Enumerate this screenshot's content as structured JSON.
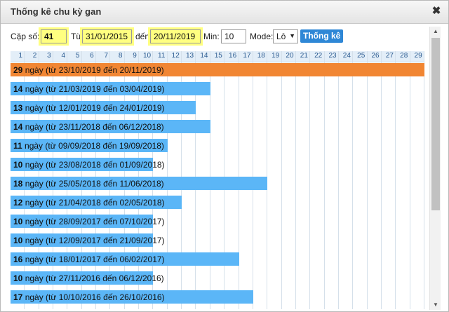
{
  "dialog": {
    "title": "Thống kê chu kỳ gan",
    "close_glyph": "✖"
  },
  "toolbar": {
    "pair_label": "Cặp số:",
    "pair_value": "41",
    "from_label": "Từ",
    "from_value": "31/01/2015",
    "to_label": "đến",
    "to_value": "20/11/2019",
    "min_label": "Min:",
    "min_value": "10",
    "mode_label": "Mode:",
    "mode_value": "Lô",
    "submit_label": "Thống kê"
  },
  "chart_data": {
    "type": "bar",
    "columns": [
      "1",
      "2",
      "3",
      "4",
      "5",
      "6",
      "7",
      "8",
      "9",
      "10",
      "11",
      "12",
      "13",
      "14",
      "15",
      "16",
      "17",
      "18",
      "19",
      "20",
      "21",
      "22",
      "23",
      "24",
      "25",
      "26",
      "27",
      "28",
      "29"
    ],
    "rows": [
      {
        "days": 29,
        "text": " ngày (từ 23/10/2019 đến 20/11/2019)",
        "color": "orange"
      },
      {
        "days": 14,
        "text": " ngày (từ 21/03/2019 đến 03/04/2019)",
        "color": "blue"
      },
      {
        "days": 13,
        "text": " ngày (từ 12/01/2019 đến 24/01/2019)",
        "color": "blue"
      },
      {
        "days": 14,
        "text": " ngày (từ 23/11/2018 đến 06/12/2018)",
        "color": "blue"
      },
      {
        "days": 11,
        "text": " ngày (từ 09/09/2018 đến 19/09/2018)",
        "color": "blue"
      },
      {
        "days": 10,
        "text": " ngày (từ 23/08/2018 đến 01/09/2018)",
        "color": "blue"
      },
      {
        "days": 18,
        "text": " ngày (từ 25/05/2018 đến 11/06/2018)",
        "color": "blue"
      },
      {
        "days": 12,
        "text": " ngày (từ 21/04/2018 đến 02/05/2018)",
        "color": "blue"
      },
      {
        "days": 10,
        "text": " ngày (từ 28/09/2017 đến 07/10/2017)",
        "color": "blue"
      },
      {
        "days": 10,
        "text": " ngày (từ 12/09/2017 đến 21/09/2017)",
        "color": "blue"
      },
      {
        "days": 16,
        "text": " ngày (từ 18/01/2017 đến 06/02/2017)",
        "color": "blue"
      },
      {
        "days": 10,
        "text": " ngày (từ 27/11/2016 đến 06/12/2016)",
        "color": "blue"
      },
      {
        "days": 17,
        "text": " ngày (từ 10/10/2016 đến 26/10/2016)",
        "color": "blue"
      }
    ]
  },
  "colors": {
    "orange": "#f18633",
    "blue": "#5bb6f7",
    "highlight": "#ffff80",
    "button": "#2e87d6"
  },
  "scrollbar": {
    "up_glyph": "▲",
    "down_glyph": "▼"
  }
}
